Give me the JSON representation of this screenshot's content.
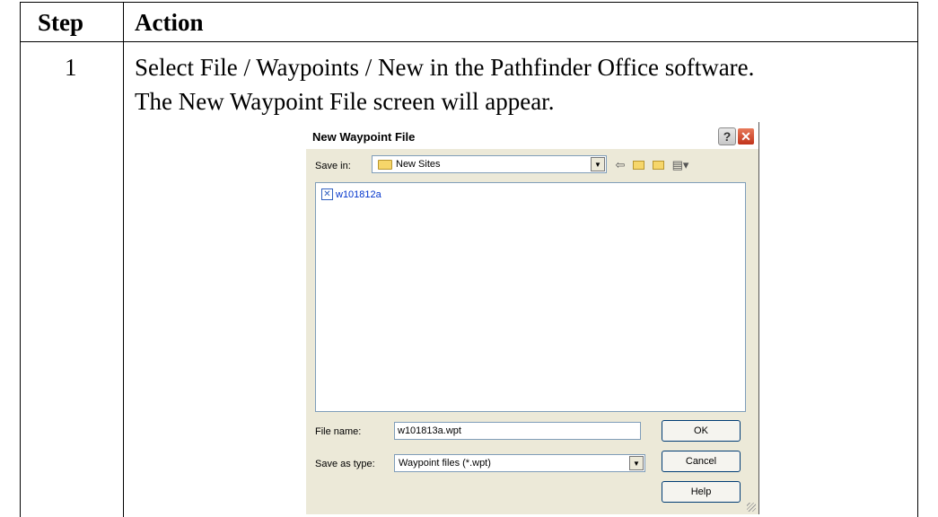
{
  "table": {
    "headers": [
      "Step",
      "Action"
    ],
    "rows": [
      {
        "step": "1",
        "lines": [
          "Select File / Waypoints / New in the Pathfinder Office software.",
          "The New Waypoint File screen will appear."
        ]
      }
    ]
  },
  "dialog": {
    "title": "New Waypoint File",
    "help_glyph": "?",
    "close_glyph": "✕",
    "save_in_label": "Save in:",
    "save_in_value": "New Sites",
    "files": [
      "w101812a"
    ],
    "file_name_label": "File name:",
    "file_name_value": "w101813a.wpt",
    "save_as_type_label": "Save as type:",
    "save_as_type_value": "Waypoint files (*.wpt)",
    "ok_label": "OK",
    "cancel_label": "Cancel",
    "help_label": "Help",
    "toolbar_icons": [
      "back-arrow-icon",
      "up-folder-icon",
      "new-folder-icon",
      "view-menu-icon"
    ]
  },
  "colors": {
    "dialog_bg": "#ece9d8",
    "close_button": "#c1331b",
    "file_link": "#0033cc",
    "input_border": "#7f9db9"
  }
}
